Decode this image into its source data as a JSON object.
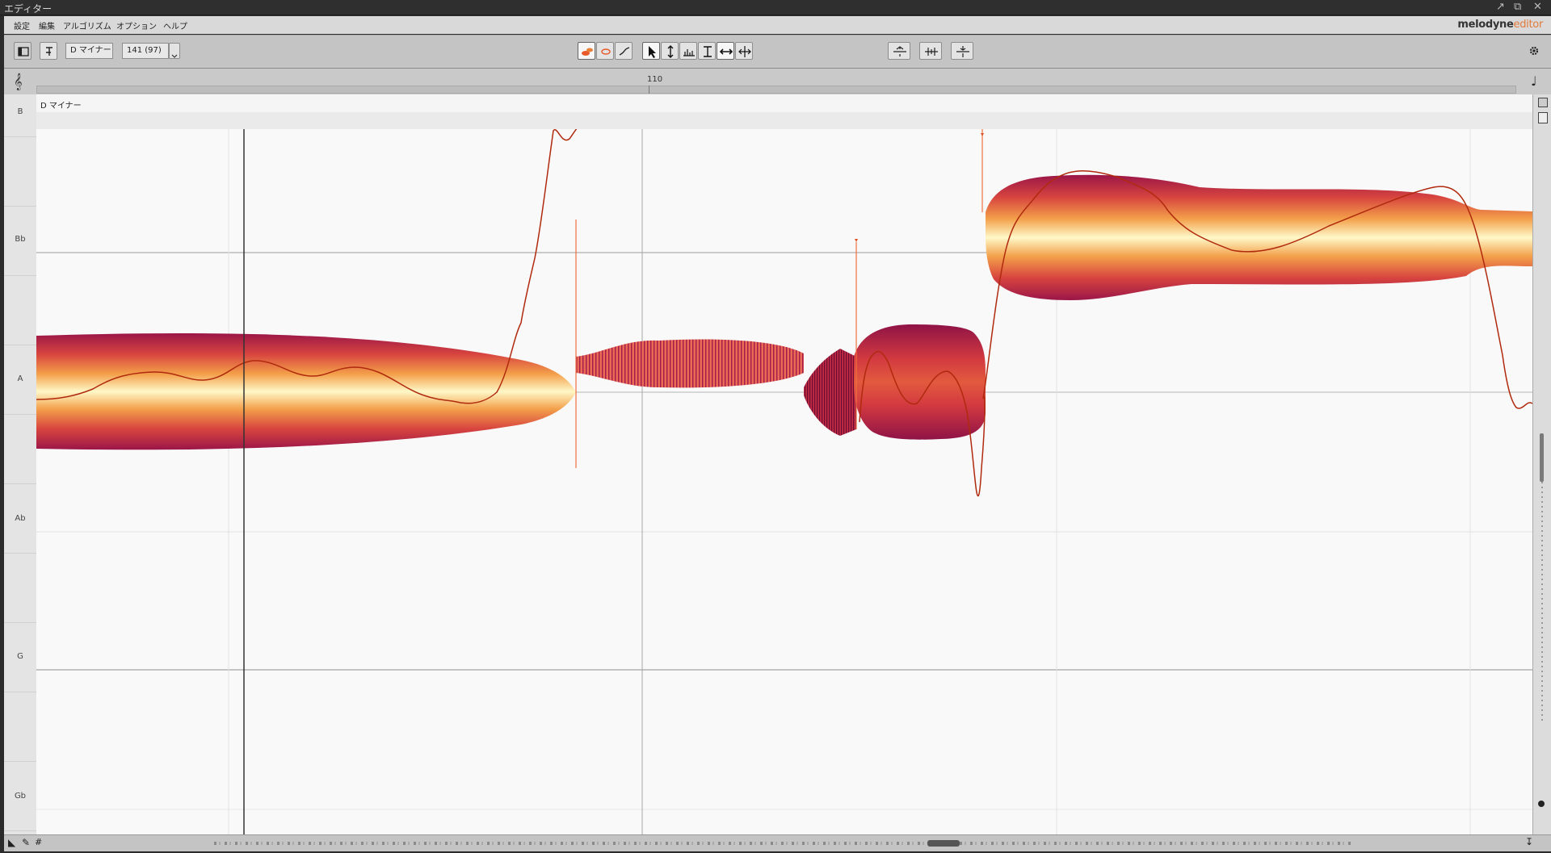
{
  "window": {
    "title": "エディター"
  },
  "menu": {
    "items": [
      "設定",
      "編集",
      "アルゴリズム",
      "オプション",
      "ヘルプ"
    ]
  },
  "brand": {
    "name": "melodyne",
    "suffix": "editor"
  },
  "toolbar": {
    "scale_button": "D マイナー",
    "tempo_value": "141 (97)"
  },
  "ruler": {
    "bar_number": "110"
  },
  "scale_bar": {
    "label": "D マイナー"
  },
  "pitch_labels": [
    "B",
    "Bb",
    "A",
    "Ab",
    "G",
    "Gb"
  ],
  "colors": {
    "blob_core": "#fff7c0",
    "blob_mid": "#f2a24a",
    "blob_edge": "#a0174a",
    "pitch_curve": "#b02a0e",
    "note_sep": "#f07040"
  },
  "icons": [
    "sidebar-toggle-icon",
    "macro-icon",
    "pitch-blob-tool-icon",
    "formant-tool-icon",
    "pitch-curve-tool-icon",
    "pointer-tool-icon",
    "pitch-tool-icon",
    "amplitude-tool-icon",
    "formant-height-icon",
    "timing-tool-icon",
    "note-separation-icon",
    "quantize-pitch-icon",
    "quantize-time-icon",
    "pitch-drift-icon",
    "gear-icon",
    "treble-clef-icon",
    "note-icon"
  ]
}
